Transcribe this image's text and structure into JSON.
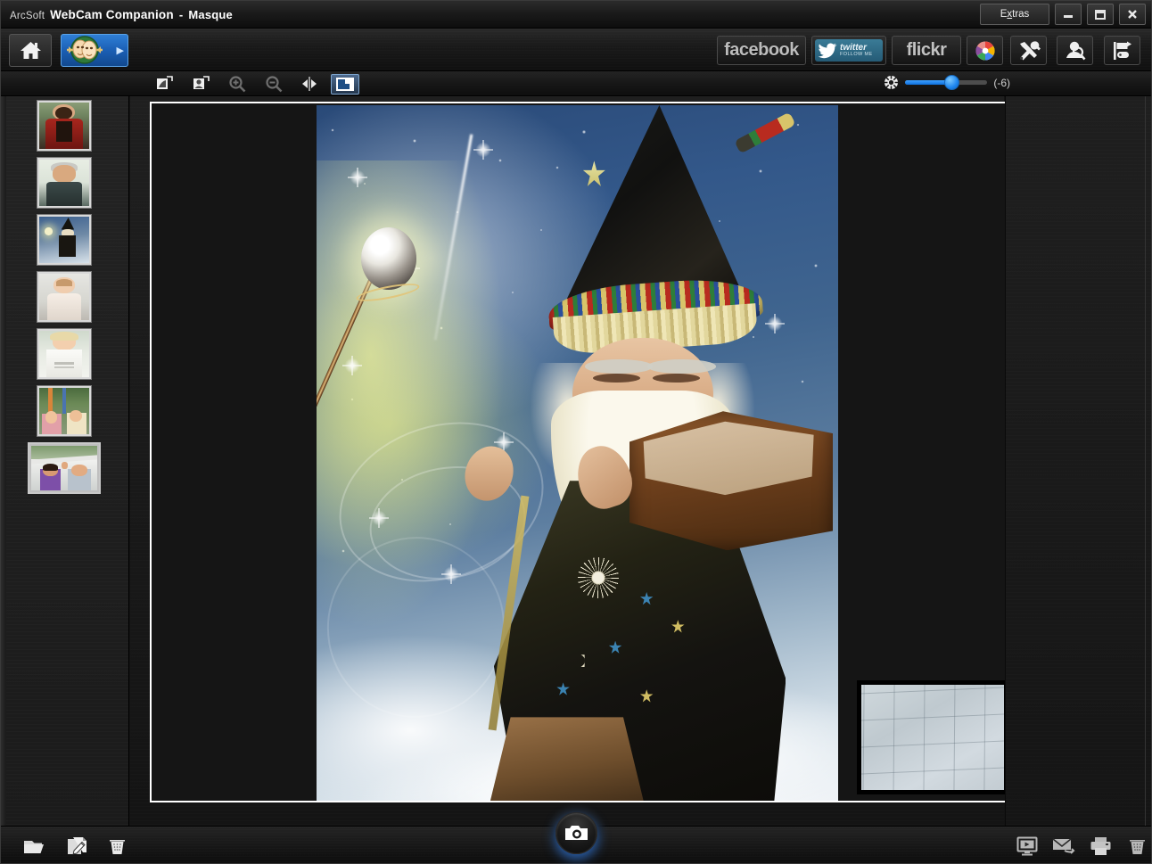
{
  "window": {
    "brand": "ArcSoft",
    "app_name": "WebCam Companion",
    "separator": "-",
    "mode": "Masque",
    "extras_label_pre": "E",
    "extras_label_accel": "x",
    "extras_label_post": "tras",
    "extras_label": "Extras",
    "minimize_label": "Minimize",
    "maximize_label": "Maximize",
    "close_label": "Close"
  },
  "topbar": {
    "home_label": "Home",
    "masque_label": "Masque",
    "masque_arrow": "▶",
    "social": [
      {
        "name": "facebook",
        "label": "facebook"
      },
      {
        "name": "twitter",
        "label": "twitter",
        "sub_label": "FOLLOW ME"
      },
      {
        "name": "flickr",
        "label": "flickr"
      }
    ],
    "tools": [
      {
        "name": "picasa-button",
        "label": "Picasa"
      },
      {
        "name": "settings-button",
        "label": "Tools"
      },
      {
        "name": "help-button",
        "label": "Help"
      },
      {
        "name": "export-button",
        "label": "Export"
      }
    ]
  },
  "edit_toolbar": {
    "buttons": [
      {
        "name": "rotate-left-button",
        "label": "Rotate Left",
        "state": "enabled"
      },
      {
        "name": "rotate-right-button",
        "label": "Rotate Right",
        "state": "enabled"
      },
      {
        "name": "zoom-in-button",
        "label": "Zoom In",
        "state": "disabled"
      },
      {
        "name": "zoom-out-button",
        "label": "Zoom Out",
        "state": "disabled"
      },
      {
        "name": "mirror-button",
        "label": "Mirror",
        "state": "enabled"
      },
      {
        "name": "preview-toggle-button",
        "label": "Preview Overlay",
        "state": "active"
      }
    ],
    "slider": {
      "icon": "aperture-icon",
      "label": "Exposure",
      "value": "(-6)",
      "percent": 56
    }
  },
  "filmstrip": {
    "items": [
      {
        "name": "thumbnail-1",
        "label": "Woman in red dress",
        "selected": false
      },
      {
        "name": "thumbnail-2",
        "label": "Man in dark shirt",
        "selected": false
      },
      {
        "name": "thumbnail-3",
        "label": "Wizard masque",
        "selected": false
      },
      {
        "name": "thumbnail-4",
        "label": "Baby in white",
        "selected": false
      },
      {
        "name": "thumbnail-5",
        "label": "Bride portrait",
        "selected": false
      },
      {
        "name": "thumbnail-6",
        "label": "Couple on ride",
        "selected": false
      },
      {
        "name": "thumbnail-7",
        "label": "Couple waving in car",
        "selected": true
      }
    ]
  },
  "canvas": {
    "photo_name": "wizard-masque-photo",
    "photo_label": "Wizard with glowing staff and open book",
    "pip_name": "live-preview",
    "pip_label": "Live webcam preview"
  },
  "bottombar": {
    "left_buttons": [
      {
        "name": "open-folder-button",
        "label": "Open Folder"
      },
      {
        "name": "edit-button",
        "label": "Edit"
      },
      {
        "name": "trash-button",
        "label": "Trash"
      }
    ],
    "capture": {
      "name": "capture-button",
      "label": "Capture"
    },
    "right_buttons": [
      {
        "name": "slideshow-button",
        "label": "Slideshow"
      },
      {
        "name": "email-button",
        "label": "Email"
      },
      {
        "name": "print-button",
        "label": "Print"
      },
      {
        "name": "delete-button",
        "label": "Delete"
      }
    ]
  },
  "colors": {
    "accent_blue": "#1e86f0",
    "active_tab": "#1b5fb4",
    "panel_dark": "#1a1a1a",
    "titlebar": "#1b1b1b",
    "text_light": "#e8e8e8"
  }
}
